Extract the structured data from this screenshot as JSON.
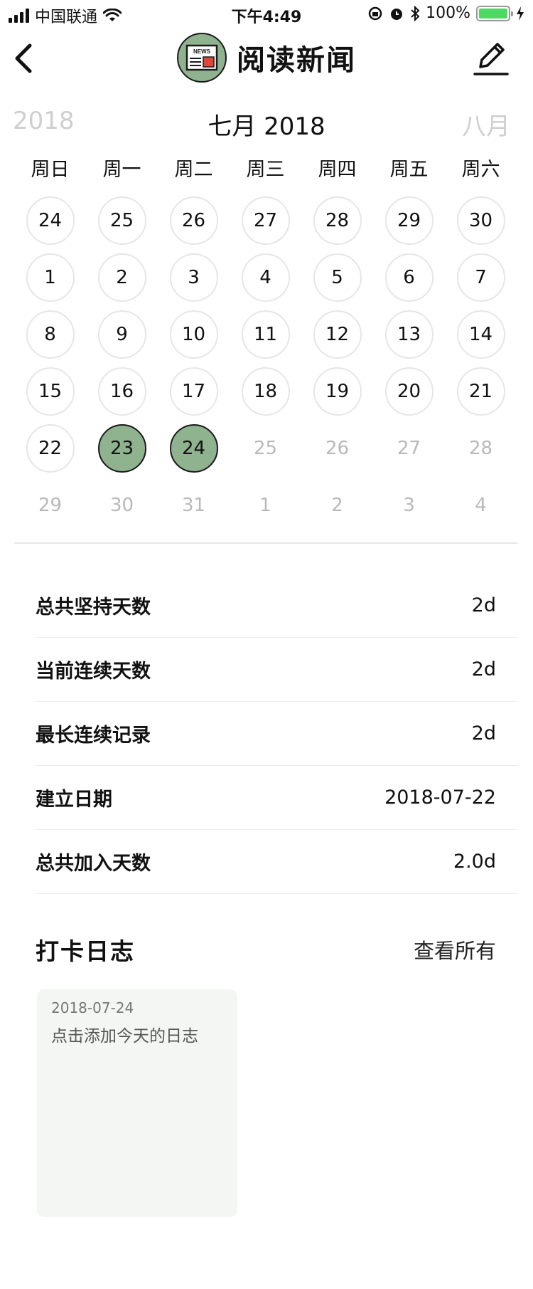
{
  "status_bar": {
    "carrier": "中国联通",
    "time": "下午4:49",
    "battery": "100%",
    "icons": [
      "signal-icon",
      "wifi-icon",
      "orientation-lock-icon",
      "alarm-icon",
      "bluetooth-icon",
      "battery-icon",
      "charging-icon"
    ]
  },
  "nav": {
    "title": "阅读新闻",
    "logo_text": "NEWS",
    "icons": {
      "back": "chevron-left-icon",
      "edit": "pencil-icon"
    }
  },
  "calendar": {
    "prev_label": "2018",
    "month_title": "七月 2018",
    "next_label": "八月",
    "weekdays": [
      "周日",
      "周一",
      "周二",
      "周三",
      "周四",
      "周五",
      "周六"
    ],
    "days": [
      {
        "n": "24",
        "s": "in"
      },
      {
        "n": "25",
        "s": "in"
      },
      {
        "n": "26",
        "s": "in"
      },
      {
        "n": "27",
        "s": "in"
      },
      {
        "n": "28",
        "s": "in"
      },
      {
        "n": "29",
        "s": "in"
      },
      {
        "n": "30",
        "s": "in"
      },
      {
        "n": "1",
        "s": "in"
      },
      {
        "n": "2",
        "s": "in"
      },
      {
        "n": "3",
        "s": "in"
      },
      {
        "n": "4",
        "s": "in"
      },
      {
        "n": "5",
        "s": "in"
      },
      {
        "n": "6",
        "s": "in"
      },
      {
        "n": "7",
        "s": "in"
      },
      {
        "n": "8",
        "s": "in"
      },
      {
        "n": "9",
        "s": "in"
      },
      {
        "n": "10",
        "s": "in"
      },
      {
        "n": "11",
        "s": "in"
      },
      {
        "n": "12",
        "s": "in"
      },
      {
        "n": "13",
        "s": "in"
      },
      {
        "n": "14",
        "s": "in"
      },
      {
        "n": "15",
        "s": "in"
      },
      {
        "n": "16",
        "s": "in"
      },
      {
        "n": "17",
        "s": "in"
      },
      {
        "n": "18",
        "s": "in"
      },
      {
        "n": "19",
        "s": "in"
      },
      {
        "n": "20",
        "s": "in"
      },
      {
        "n": "21",
        "s": "in"
      },
      {
        "n": "22",
        "s": "in"
      },
      {
        "n": "23",
        "s": "sel"
      },
      {
        "n": "24",
        "s": "sel"
      },
      {
        "n": "25",
        "s": "out"
      },
      {
        "n": "26",
        "s": "out"
      },
      {
        "n": "27",
        "s": "out"
      },
      {
        "n": "28",
        "s": "out"
      },
      {
        "n": "29",
        "s": "out"
      },
      {
        "n": "30",
        "s": "out"
      },
      {
        "n": "31",
        "s": "out"
      },
      {
        "n": "1",
        "s": "out"
      },
      {
        "n": "2",
        "s": "out"
      },
      {
        "n": "3",
        "s": "out"
      },
      {
        "n": "4",
        "s": "out"
      }
    ]
  },
  "stats": [
    {
      "label": "总共坚持天数",
      "value": "2d"
    },
    {
      "label": "当前连续天数",
      "value": "2d"
    },
    {
      "label": "最长连续记录",
      "value": "2d"
    },
    {
      "label": "建立日期",
      "value": "2018-07-22"
    },
    {
      "label": "总共加入天数",
      "value": "2.0d"
    }
  ],
  "log": {
    "title": "打卡日志",
    "view_all": "查看所有",
    "card": {
      "date": "2018-07-24",
      "text": "点击添加今天的日志"
    }
  },
  "colors": {
    "accent": "#8fb28f",
    "battery": "#4cd964",
    "muted": "#b9b9b9",
    "card_bg": "#f4f6f4"
  }
}
